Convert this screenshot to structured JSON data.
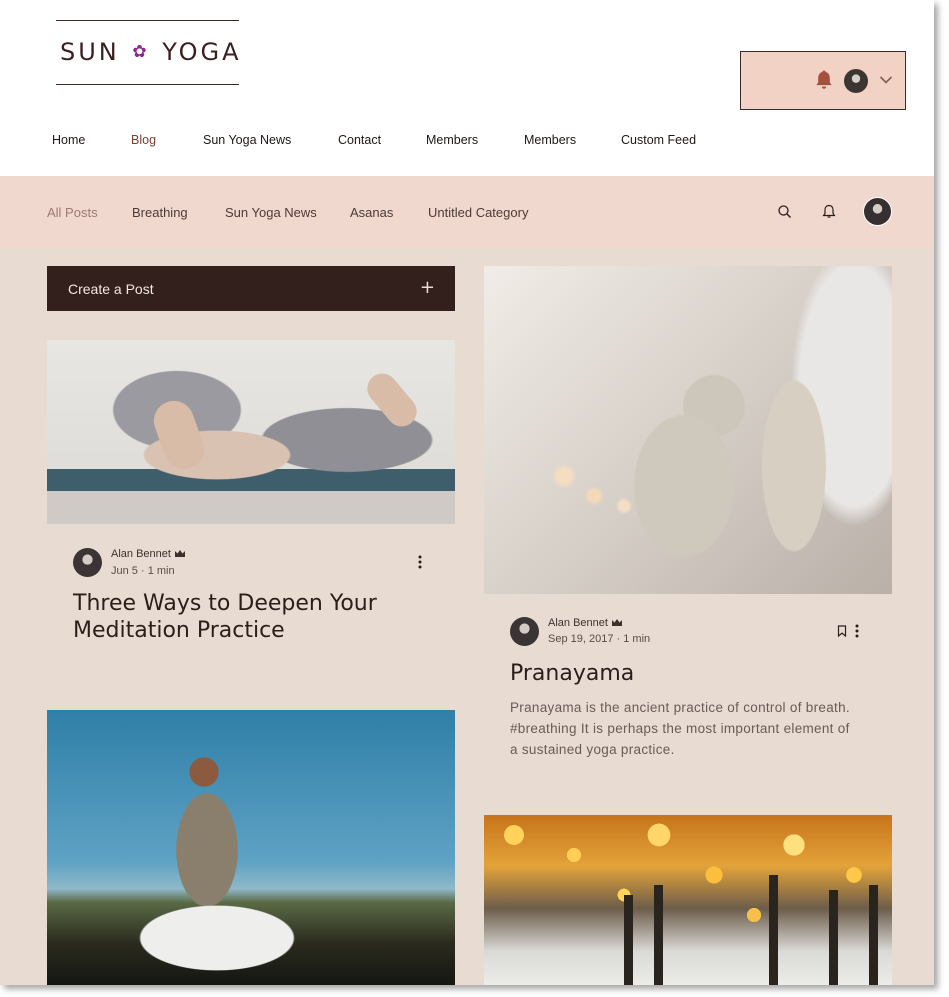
{
  "colors": {
    "brand_dark": "#33201d",
    "category_bar": "#f1d8cf",
    "member_box": "#f2d2c5",
    "page_bg": "#e8dcd2",
    "active_nav": "#7a3f2e",
    "bell": "#a4503f"
  },
  "header": {
    "logo_left": "SUN",
    "logo_right": "YOGA",
    "logo_mark": "flower-icon"
  },
  "nav": {
    "items": [
      {
        "label": "Home"
      },
      {
        "label": "Blog",
        "active": true
      },
      {
        "label": "Sun Yoga News"
      },
      {
        "label": "Contact"
      },
      {
        "label": "Members"
      },
      {
        "label": "Members"
      },
      {
        "label": "Custom Feed"
      }
    ]
  },
  "categories": {
    "items": [
      {
        "label": "All Posts",
        "active": true
      },
      {
        "label": "Breathing"
      },
      {
        "label": "Sun Yoga News"
      },
      {
        "label": "Asanas"
      },
      {
        "label": "Untitled Category"
      }
    ],
    "icons": [
      "search-icon",
      "bell-icon",
      "avatar"
    ]
  },
  "create_post": {
    "label": "Create a Post",
    "icon": "plus-icon"
  },
  "posts": [
    {
      "author": "Alan Bennet",
      "date": "Jun 5",
      "read_time": "1 min",
      "title": "Three Ways to Deepen Your Meditation Practice"
    },
    {
      "author": "Alan Bennet",
      "date": "Sep 19, 2017",
      "read_time": "1 min",
      "title": "Pranayama",
      "excerpt": "Pranayama is the ancient practice of control of breath. #breathing It is perhaps the most important element of a sustained yoga practice."
    }
  ],
  "separator": "·"
}
